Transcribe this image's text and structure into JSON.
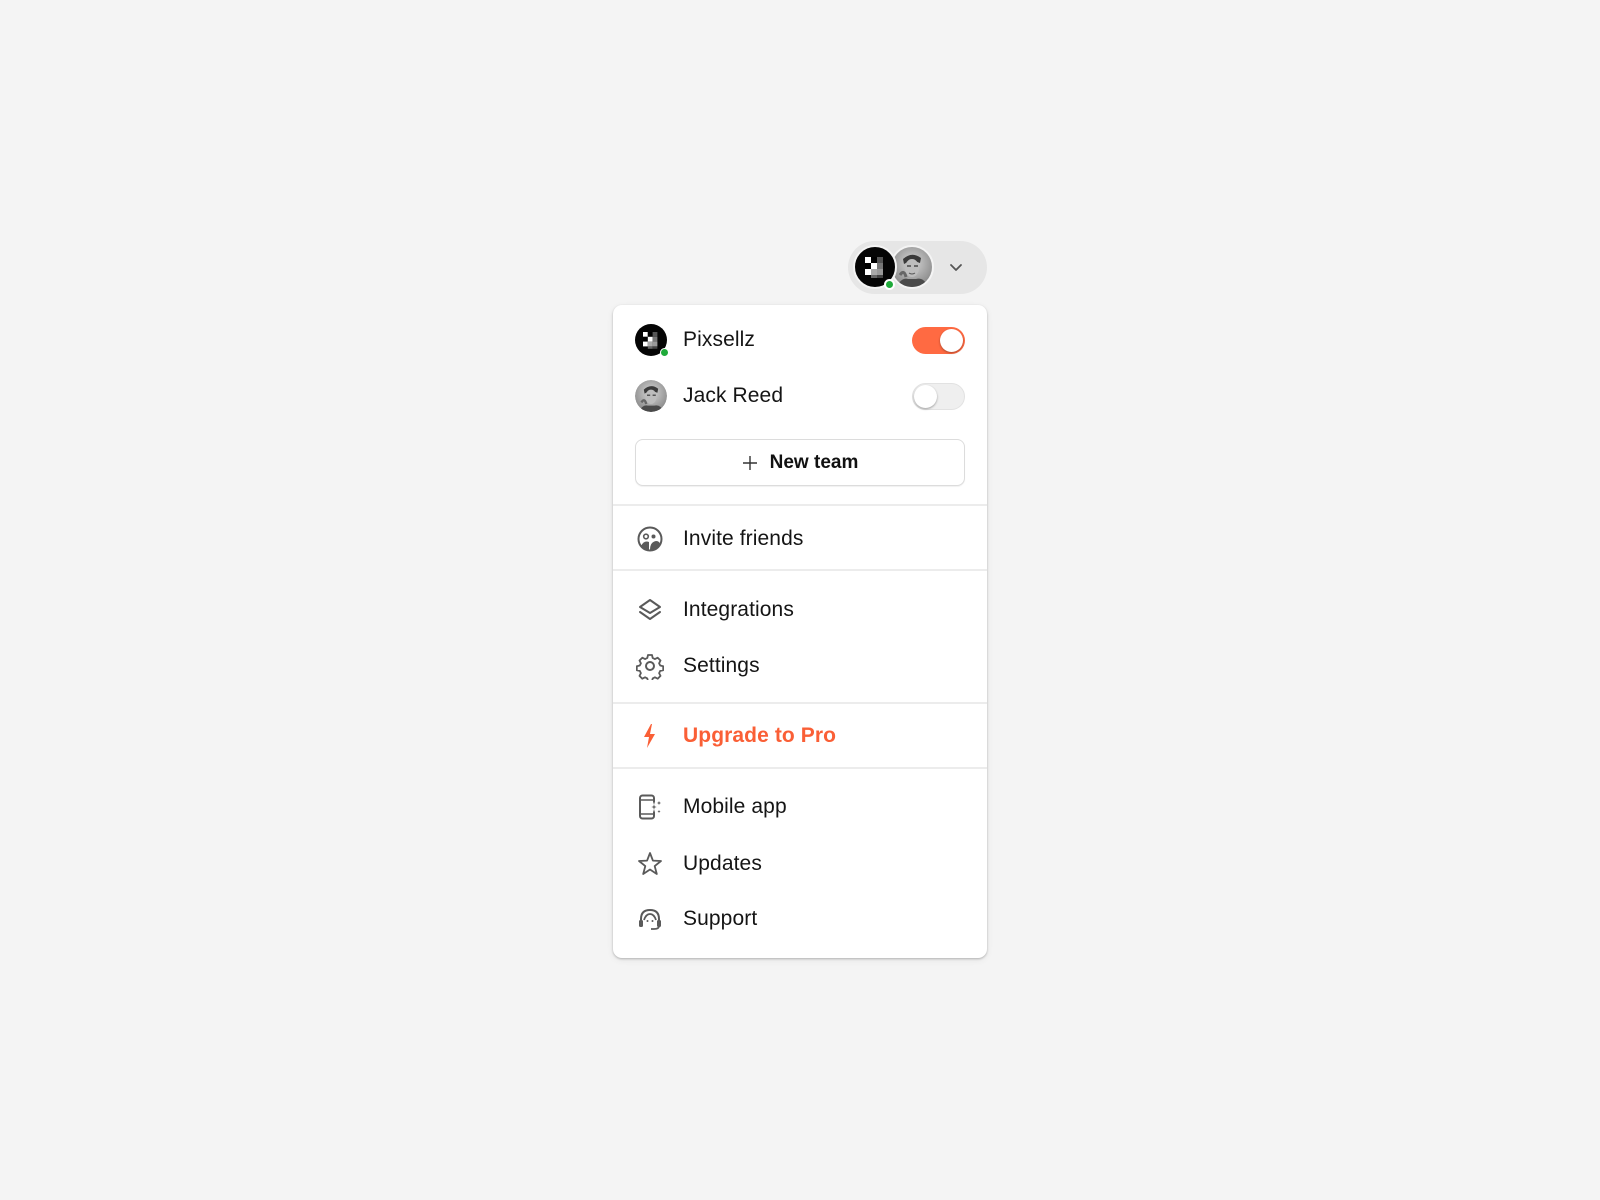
{
  "account_switcher": {
    "team_avatar": "pixsellz-logo",
    "user_avatar": "jack-reed-photo",
    "status": "online",
    "chevron": "chevron-down-icon"
  },
  "colors": {
    "accent": "#ff6a42",
    "accent_text": "#fa5f36",
    "online": "#1faa3a",
    "icon": "#5a5a5a",
    "background": "#f4f4f4"
  },
  "teams": [
    {
      "name": "Pixsellz",
      "avatar": "pixsellz-logo",
      "online": true,
      "enabled": true
    },
    {
      "name": "Jack Reed",
      "avatar": "jack-reed-photo",
      "online": false,
      "enabled": false
    }
  ],
  "new_team": {
    "label": "New team",
    "icon": "plus-icon"
  },
  "menu": {
    "invite_friends": {
      "label": "Invite friends",
      "icon": "friends-icon"
    },
    "integrations": {
      "label": "Integrations",
      "icon": "layers-icon"
    },
    "settings": {
      "label": "Settings",
      "icon": "gear-icon"
    },
    "upgrade": {
      "label": "Upgrade to Pro",
      "icon": "lightning-icon"
    },
    "mobile_app": {
      "label": "Mobile app",
      "icon": "mobile-sparkle-icon"
    },
    "updates": {
      "label": "Updates",
      "icon": "star-icon"
    },
    "support": {
      "label": "Support",
      "icon": "headset-icon"
    }
  }
}
